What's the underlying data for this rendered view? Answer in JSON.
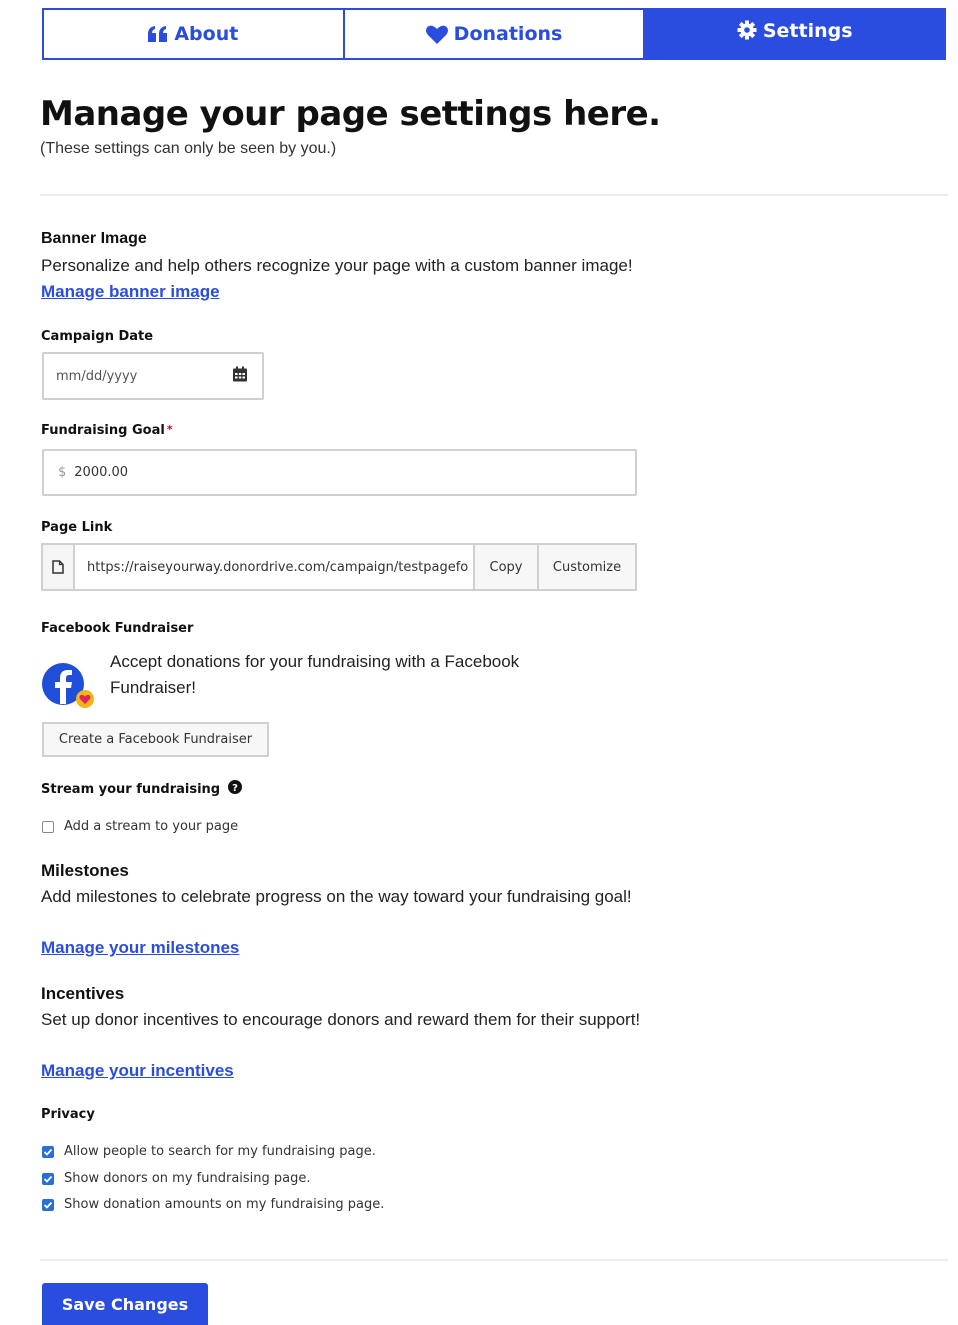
{
  "tabs": {
    "about": "About",
    "donations": "Donations",
    "settings": "Settings"
  },
  "header": {
    "title": "Manage your page settings here.",
    "subtitle": "(These settings can only be seen by you.)"
  },
  "banner": {
    "title": "Banner Image",
    "description": "Personalize and help others recognize your page with a custom banner image!",
    "link": "Manage banner image"
  },
  "campaign_date": {
    "label": "Campaign Date",
    "placeholder": "mm/dd/yyyy"
  },
  "goal": {
    "label": "Fundraising Goal",
    "required_mark": "*",
    "currency": "$",
    "value": "2000.00"
  },
  "page_link": {
    "label": "Page Link",
    "url": "https://raiseyourway.donordrive.com/campaign/testpagefo",
    "copy": "Copy",
    "customize": "Customize"
  },
  "facebook": {
    "label": "Facebook Fundraiser",
    "description": "Accept donations for your fundraising with a Facebook Fundraiser!",
    "button": "Create a Facebook Fundraiser"
  },
  "stream": {
    "label": "Stream your fundraising",
    "checkbox": "Add a stream to your page",
    "checked": false
  },
  "milestones": {
    "title": "Milestones",
    "description": "Add milestones to celebrate progress on the way toward your fundraising goal!",
    "link": "Manage your milestones"
  },
  "incentives": {
    "title": "Incentives",
    "description": "Set up donor incentives to encourage donors and reward them for their support!",
    "link": "Manage your incentives"
  },
  "privacy": {
    "label": "Privacy",
    "options": [
      {
        "label": "Allow people to search for my fundraising page.",
        "checked": true
      },
      {
        "label": "Show donors on my fundraising page.",
        "checked": true
      },
      {
        "label": "Show donation amounts on my fundraising page.",
        "checked": true
      }
    ]
  },
  "save_button": "Save Changes",
  "colors": {
    "accent": "#2a4de0",
    "checkbox": "#2a6fd6",
    "required": "#d0021b"
  }
}
